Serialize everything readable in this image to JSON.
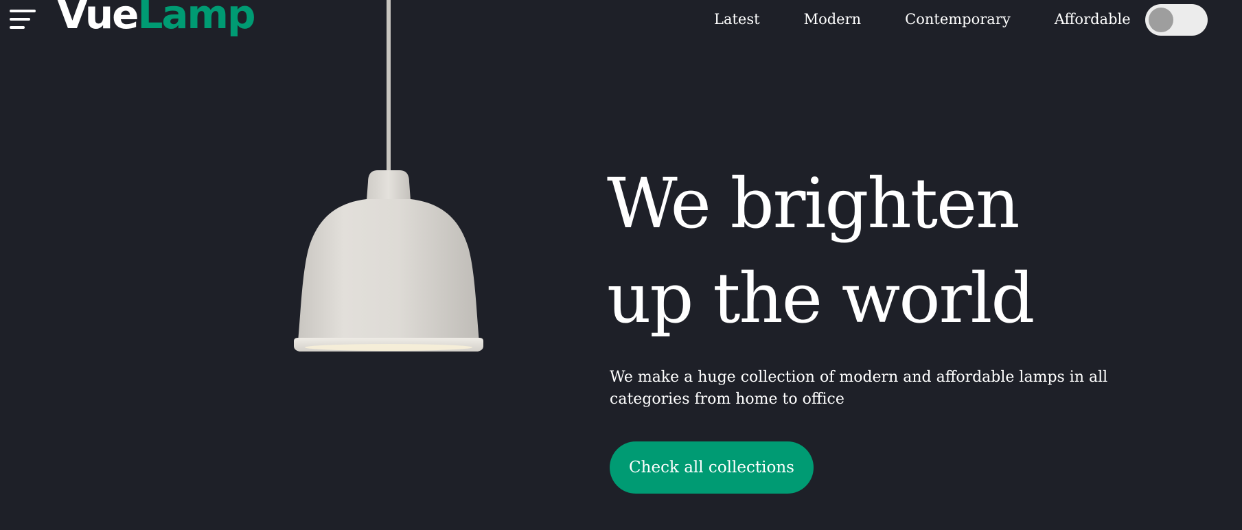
{
  "header": {
    "menu_icon": "hamburger-menu-icon",
    "logo": {
      "part1": "Vue",
      "part2": "Lamp"
    },
    "nav": [
      {
        "label": "Latest"
      },
      {
        "label": "Modern"
      },
      {
        "label": "Contemporary"
      },
      {
        "label": "Affordable"
      }
    ],
    "theme_toggle": {
      "state": "off"
    }
  },
  "hero": {
    "image_icon": "pendant-lamp-image",
    "title_line1": "We brighten",
    "title_line2": "up the world",
    "description": "We make a huge collection of modern and affordable lamps in all categories from home to office",
    "cta_label": "Check all collections"
  },
  "colors": {
    "background": "#1e2028",
    "accent": "#009b73",
    "text": "#ffffff",
    "toggle_track": "#ececec",
    "toggle_knob": "#9e9e9e"
  }
}
